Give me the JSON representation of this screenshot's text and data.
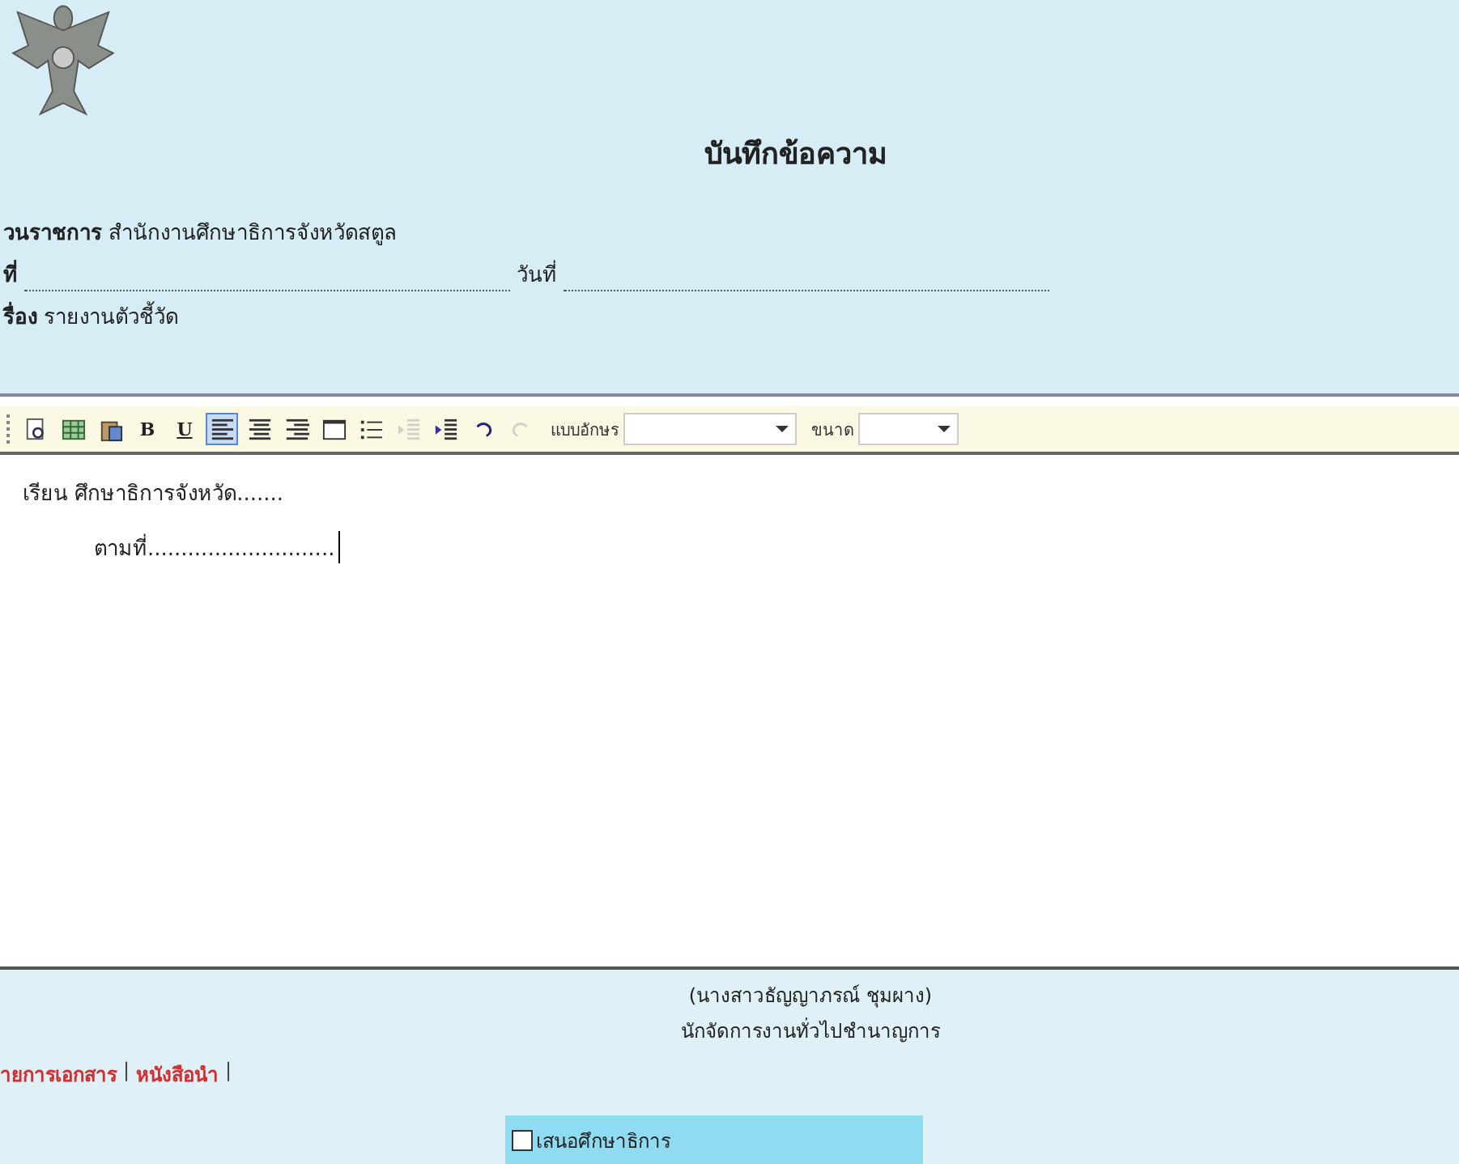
{
  "memo": {
    "title": "บันทึกข้อความ",
    "agency_label": "วนราชการ",
    "agency": "สำนักงานศึกษาธิการจังหวัดสตูล",
    "ref_label": "ที่",
    "date_label": "วันที่",
    "subject_label": "รื่อง",
    "subject": "รายงานตัวชี้วัด"
  },
  "toolbar": {
    "items": [
      {
        "kind": "preview",
        "selected": false,
        "disabled": false
      },
      {
        "kind": "table",
        "selected": false,
        "disabled": false
      },
      {
        "kind": "paste",
        "selected": false,
        "disabled": false
      },
      {
        "kind": "bold",
        "label": "B",
        "selected": false,
        "disabled": false
      },
      {
        "kind": "underline",
        "label": "U",
        "selected": false,
        "disabled": false
      },
      {
        "kind": "align-left",
        "selected": true,
        "disabled": false
      },
      {
        "kind": "align-center",
        "selected": false,
        "disabled": false
      },
      {
        "kind": "align-right",
        "selected": false,
        "disabled": false
      },
      {
        "kind": "box",
        "selected": false,
        "disabled": false
      },
      {
        "kind": "list",
        "selected": false,
        "disabled": false
      },
      {
        "kind": "outdent",
        "selected": false,
        "disabled": true
      },
      {
        "kind": "indent",
        "selected": false,
        "disabled": false
      },
      {
        "kind": "undo",
        "selected": false,
        "disabled": false
      },
      {
        "kind": "redo",
        "selected": false,
        "disabled": true
      }
    ],
    "font_label": "แบบอักษร",
    "size_label": "ขนาด"
  },
  "editor": {
    "lines": [
      "เรียน  ศึกษาธิการจังหวัด.......",
      "ตามที่............................"
    ]
  },
  "signature": {
    "name": "(นางสาวธัญญาภรณ์ ชุมผาง)",
    "position": "นักจัดการงานทั่วไปชำนาญการ"
  },
  "links": [
    {
      "label": "ายการเอกสาร",
      "separator": "|"
    },
    {
      "label": "หนังสือนำ",
      "separator": "|"
    }
  ],
  "approval": {
    "label": "เสนอศึกษาธิการ",
    "checked": false
  }
}
